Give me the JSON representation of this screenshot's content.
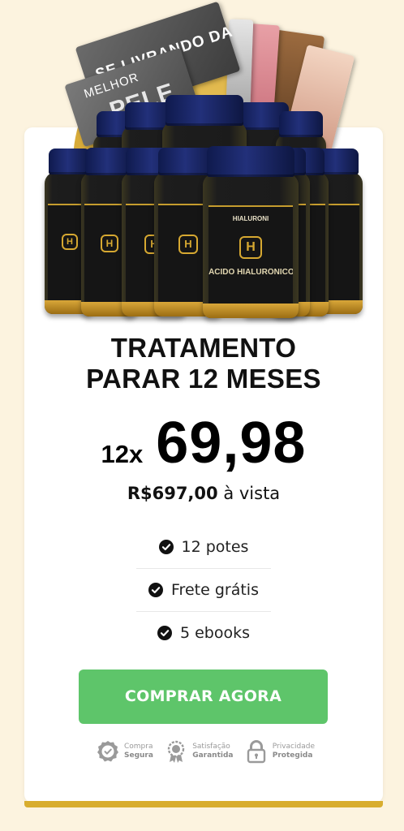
{
  "product_image": {
    "book_text_1": "SE LIVRANDO DA",
    "book_text_2": "MELHOR",
    "book_text_3": "PELE",
    "jar_brand": "HIALURONI",
    "jar_subtitle": "ÁCIDO HIALURÔNICO",
    "jar_monogram": "H"
  },
  "offer": {
    "title_line1": "TRATAMENTO",
    "title_line2": "PARAR 12 MESES",
    "installments": "12x",
    "price": "69,98",
    "cash_amount": "R$697,00",
    "cash_suffix": " à vista"
  },
  "features": [
    {
      "label": "12 potes",
      "icon": "check-circle-icon"
    },
    {
      "label": "Frete grátis",
      "icon": "check-circle-icon"
    },
    {
      "label": "5 ebooks",
      "icon": "check-circle-icon"
    }
  ],
  "cta": {
    "label": "COMPRAR AGORA"
  },
  "badges": [
    {
      "top": "Compra",
      "bottom": "Segura",
      "icon": "shield-check-icon"
    },
    {
      "top": "Satisfação",
      "bottom": "Garantida",
      "icon": "award-ribbon-icon"
    },
    {
      "top": "Privacidade",
      "bottom": "Protegida",
      "icon": "padlock-icon"
    }
  ],
  "colors": {
    "page_background": "#fcf3df",
    "card_background": "#ffffff",
    "button_green": "#5ec56a",
    "gold_accent": "#d8ad2e",
    "jar_cap_blue": "#1b2766"
  }
}
